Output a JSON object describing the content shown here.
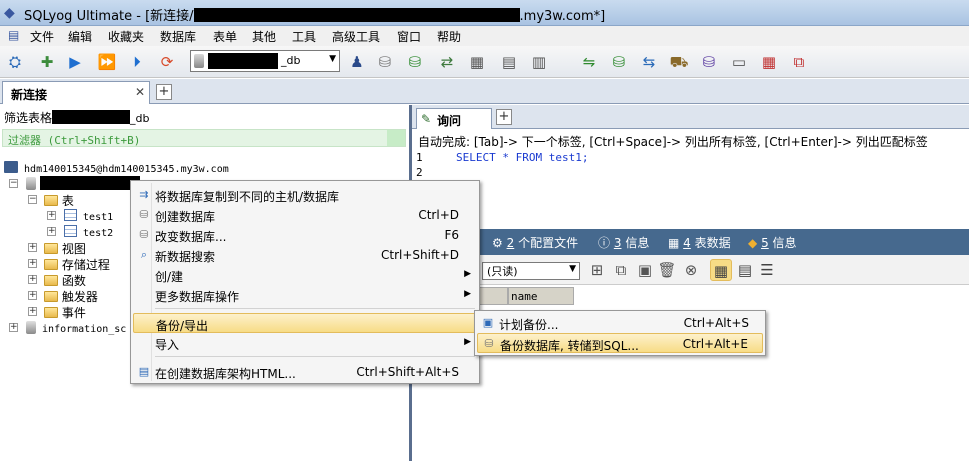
{
  "window": {
    "title_prefix": "SQLyog Ultimate - [新连接/",
    "title_suffix": ".my3w.com*]"
  },
  "menu": [
    "文件",
    "编辑",
    "收藏夹",
    "数据库",
    "表单",
    "其他",
    "工具",
    "高级工具",
    "窗口",
    "帮助"
  ],
  "toolbar": {
    "db_select_suffix": "_db"
  },
  "connection_tab": {
    "label": "新连接",
    "close": "✕",
    "add": "+"
  },
  "object_browser": {
    "filter_label": "筛选表格",
    "filter_suffix": "_db",
    "filter_placeholder": "过滤器 (Ctrl+Shift+B)",
    "server": "hdm140015345@hdm140015345.my3w.com",
    "db_suffix": "_",
    "tables_folder": "表",
    "tables": [
      "test1",
      "test2"
    ],
    "folders": [
      "视图",
      "存储过程",
      "函数",
      "触发器",
      "事件"
    ],
    "other_db": "information_sc"
  },
  "query": {
    "tab_label": "询问",
    "add": "+",
    "autocomplete_hint": "自动完成: [Tab]-> 下一个标签, [Ctrl+Space]-> 列出所有标签, [Ctrl+Enter]-> 列出匹配标签",
    "lines": [
      "1",
      "2"
    ],
    "sql": "SELECT * FROM test1;"
  },
  "result_tabs": [
    {
      "num": "2",
      "label": "个配置文件"
    },
    {
      "num": "3",
      "label": "信息"
    },
    {
      "num": "4",
      "label": "表数据"
    },
    {
      "num": "5",
      "label": "信息"
    }
  ],
  "result_toolbar": {
    "mode": "(只读)"
  },
  "grid": {
    "column": "name"
  },
  "context_menu": {
    "items": [
      {
        "label": "将数据库复制到不同的主机/数据库",
        "shortcut": ""
      },
      {
        "label": "创建数据库",
        "shortcut": "Ctrl+D"
      },
      {
        "label": "改变数据库...",
        "shortcut": "F6"
      },
      {
        "label": "新数据搜索",
        "shortcut": "Ctrl+Shift+D"
      },
      {
        "label": "创/建",
        "shortcut": ""
      },
      {
        "label": "更多数据库操作",
        "shortcut": ""
      },
      {
        "label": "备份/导出",
        "shortcut": ""
      },
      {
        "label": "导入",
        "shortcut": ""
      },
      {
        "label": "在创建数据库架构HTML...",
        "shortcut": "Ctrl+Shift+Alt+S"
      }
    ]
  },
  "submenu": {
    "items": [
      {
        "label": "计划备份...",
        "shortcut": "Ctrl+Alt+S"
      },
      {
        "label": "备份数据库, 转储到SQL...",
        "shortcut": "Ctrl+Alt+E"
      }
    ]
  },
  "colors": {
    "highlight": "#f7dc86",
    "result_tab_bg": "#46698e",
    "sql_keyword": "#1a3ad0"
  }
}
